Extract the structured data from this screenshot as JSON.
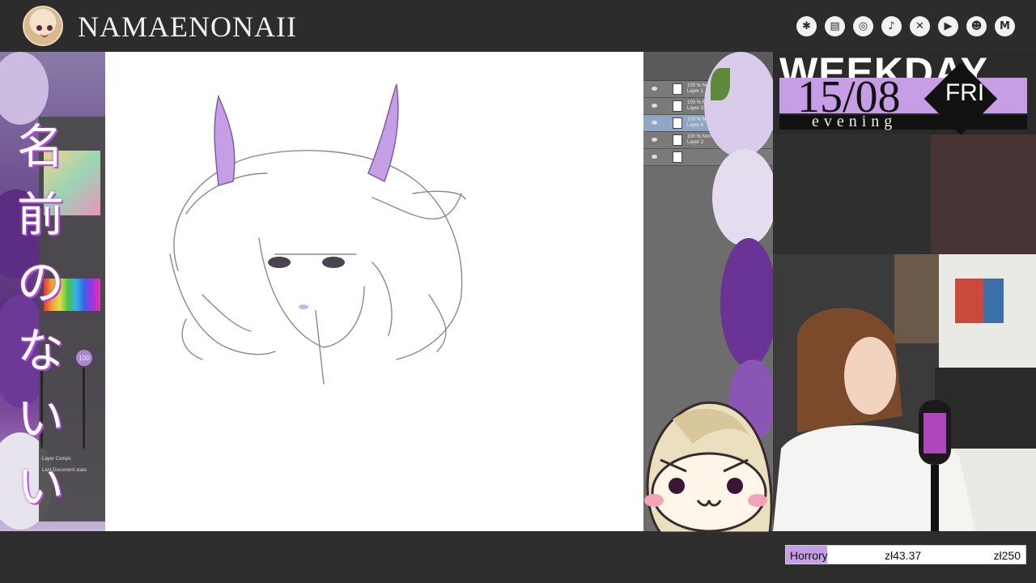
{
  "header": {
    "channel_name": "NAMAENONAII",
    "social_icons": [
      "linktree-icon",
      "twitch-icon",
      "instagram-icon",
      "tiktok-icon",
      "x-icon",
      "youtube-icon",
      "discord-icon",
      "gmail-icon"
    ]
  },
  "left_panel": {
    "vertical_text": [
      "名",
      "前",
      "の",
      "な",
      "い",
      "い"
    ],
    "brush_size": "100",
    "layer_comps_label": "Layer Comps",
    "document_state": "Last Document state"
  },
  "layers_panel": {
    "layers": [
      {
        "line1": "100 % Normal",
        "line2": "Layer 1",
        "selected": false
      },
      {
        "line1": "100 % Normal",
        "line2": "Layer 3",
        "selected": false
      },
      {
        "line1": "100 % Normal",
        "line2": "Layer 4",
        "selected": true
      },
      {
        "line1": "100 % Normal",
        "line2": "Layer 2",
        "selected": false
      },
      {
        "line1": "",
        "line2": "",
        "selected": false
      }
    ]
  },
  "schedule": {
    "banner": "WEEKDAY",
    "date": "15/08",
    "day": "FRI",
    "time_of_day": "evening"
  },
  "goal": {
    "label": "Horrory",
    "current": "zł43.37",
    "target": "zł250",
    "progress": 0.1735
  },
  "colors": {
    "accent_purple": "#c69ee6",
    "topbar_bg": "#2c2c2c"
  }
}
